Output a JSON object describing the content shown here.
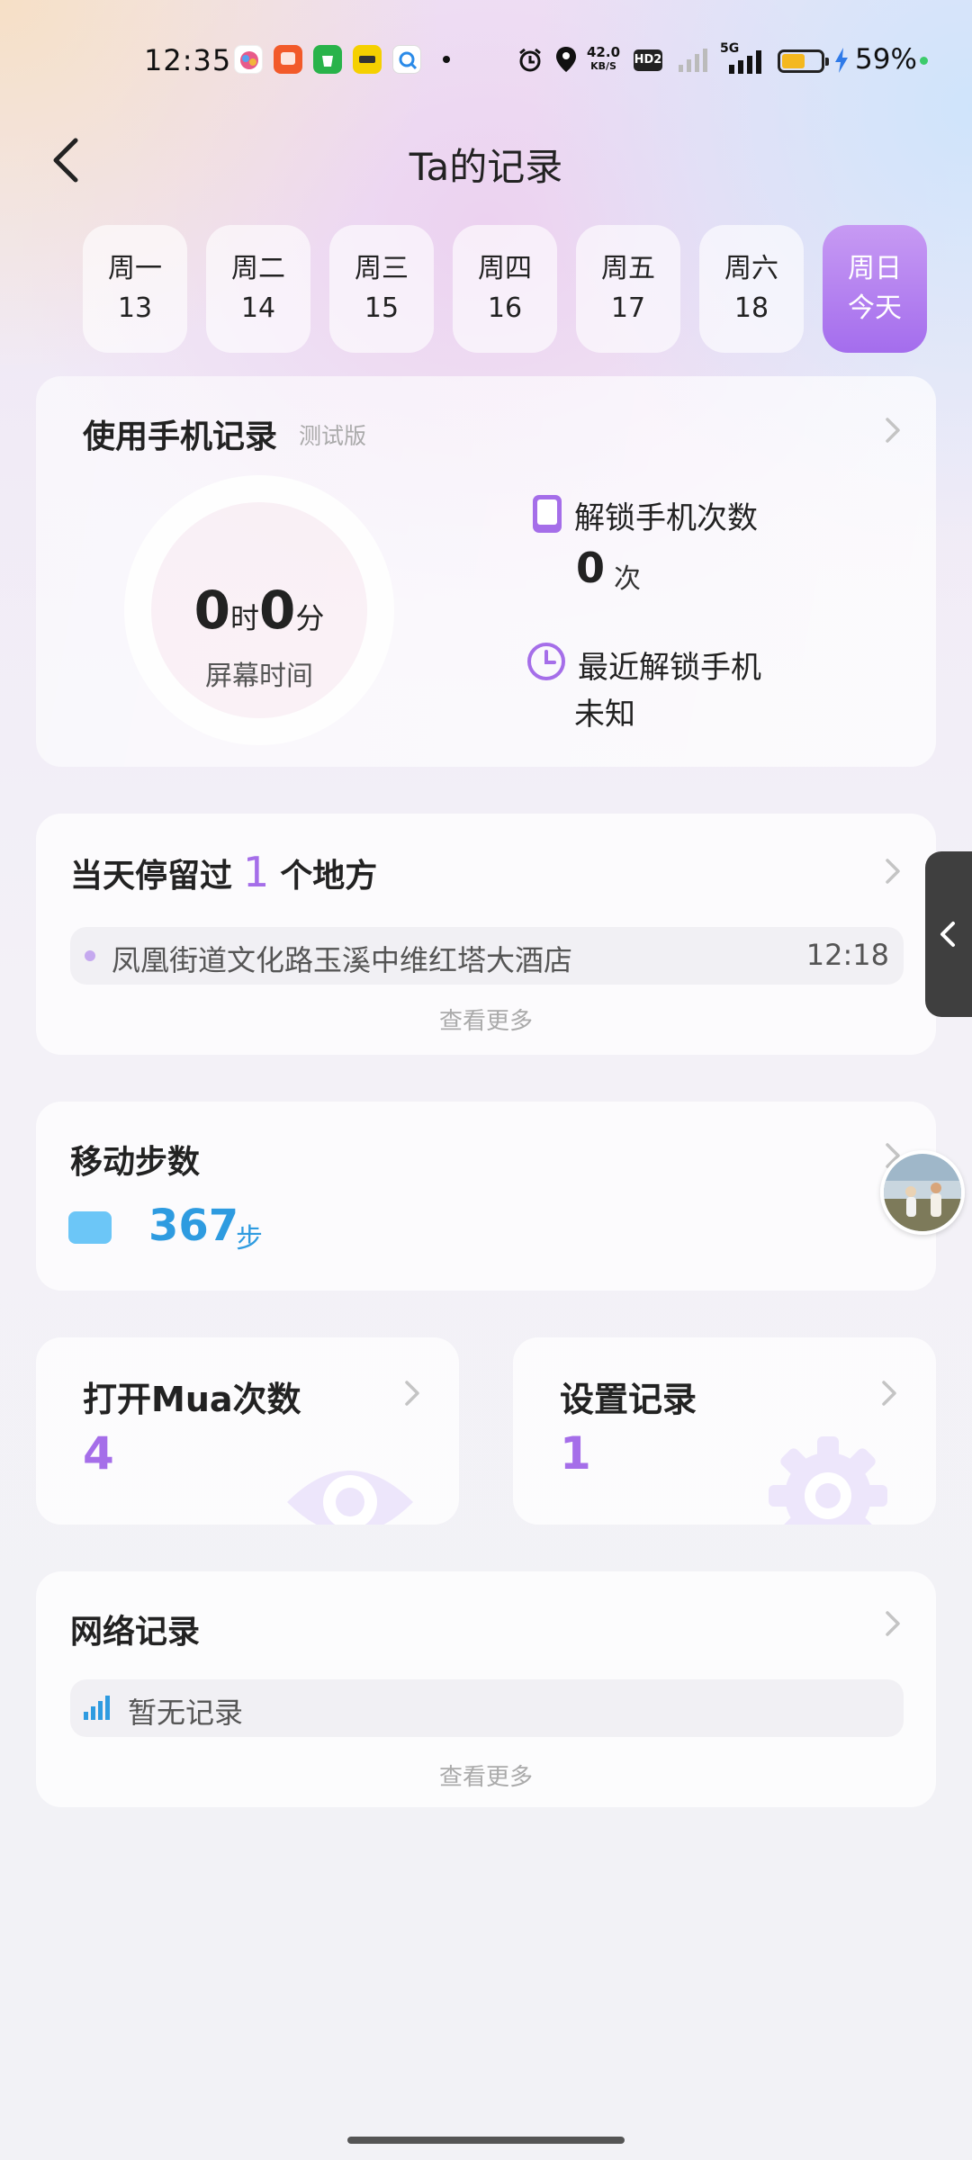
{
  "status_bar": {
    "time": "12:35",
    "network_speed_value": "42.0",
    "network_speed_unit": "KB/S",
    "hd_label": "HD2",
    "signal_label": "5G",
    "battery_percent": "59%",
    "battery_level": 0.59,
    "icons": [
      "app-icon-1",
      "app-icon-2",
      "app-icon-3",
      "app-icon-4",
      "app-icon-5",
      "alarm-icon",
      "location-icon",
      "signal-icon",
      "battery-icon",
      "charging-icon"
    ]
  },
  "header": {
    "title": "Ta的记录",
    "back_icon": "chevron-left-icon"
  },
  "week": [
    {
      "weekday": "周一",
      "date": "13"
    },
    {
      "weekday": "周二",
      "date": "14"
    },
    {
      "weekday": "周三",
      "date": "15"
    },
    {
      "weekday": "周四",
      "date": "16"
    },
    {
      "weekday": "周五",
      "date": "17"
    },
    {
      "weekday": "周六",
      "date": "18"
    },
    {
      "weekday": "周日",
      "date": "今天",
      "selected": true
    }
  ],
  "usage": {
    "title": "使用手机记录",
    "badge": "测试版",
    "hours": "0",
    "hours_unit": "时",
    "minutes": "0",
    "minutes_unit": "分",
    "ring_label": "屏幕时间",
    "unlock_count_label": "解锁手机次数",
    "unlock_count_value": "0",
    "unlock_count_unit": "次",
    "last_unlock_label": "最近解锁手机",
    "last_unlock_value": "未知"
  },
  "places": {
    "title_prefix": "当天停留过",
    "count": "1",
    "title_suffix": "个地方",
    "items": [
      {
        "name": "凤凰街道文化路玉溪中维红塔大酒店",
        "time": "12:18"
      }
    ],
    "more": "查看更多"
  },
  "steps": {
    "title": "移动步数",
    "value": "367",
    "unit": "步"
  },
  "mua": {
    "title": "打开Mua次数",
    "value": "4"
  },
  "settings_record": {
    "title": "设置记录",
    "value": "1"
  },
  "network": {
    "title": "网络记录",
    "empty_text": "暂无记录",
    "more": "查看更多"
  },
  "colors": {
    "accent_purple": "#a56ee9",
    "steps_blue": "#2e9be0",
    "battery_yellow": "#f4b81f"
  }
}
